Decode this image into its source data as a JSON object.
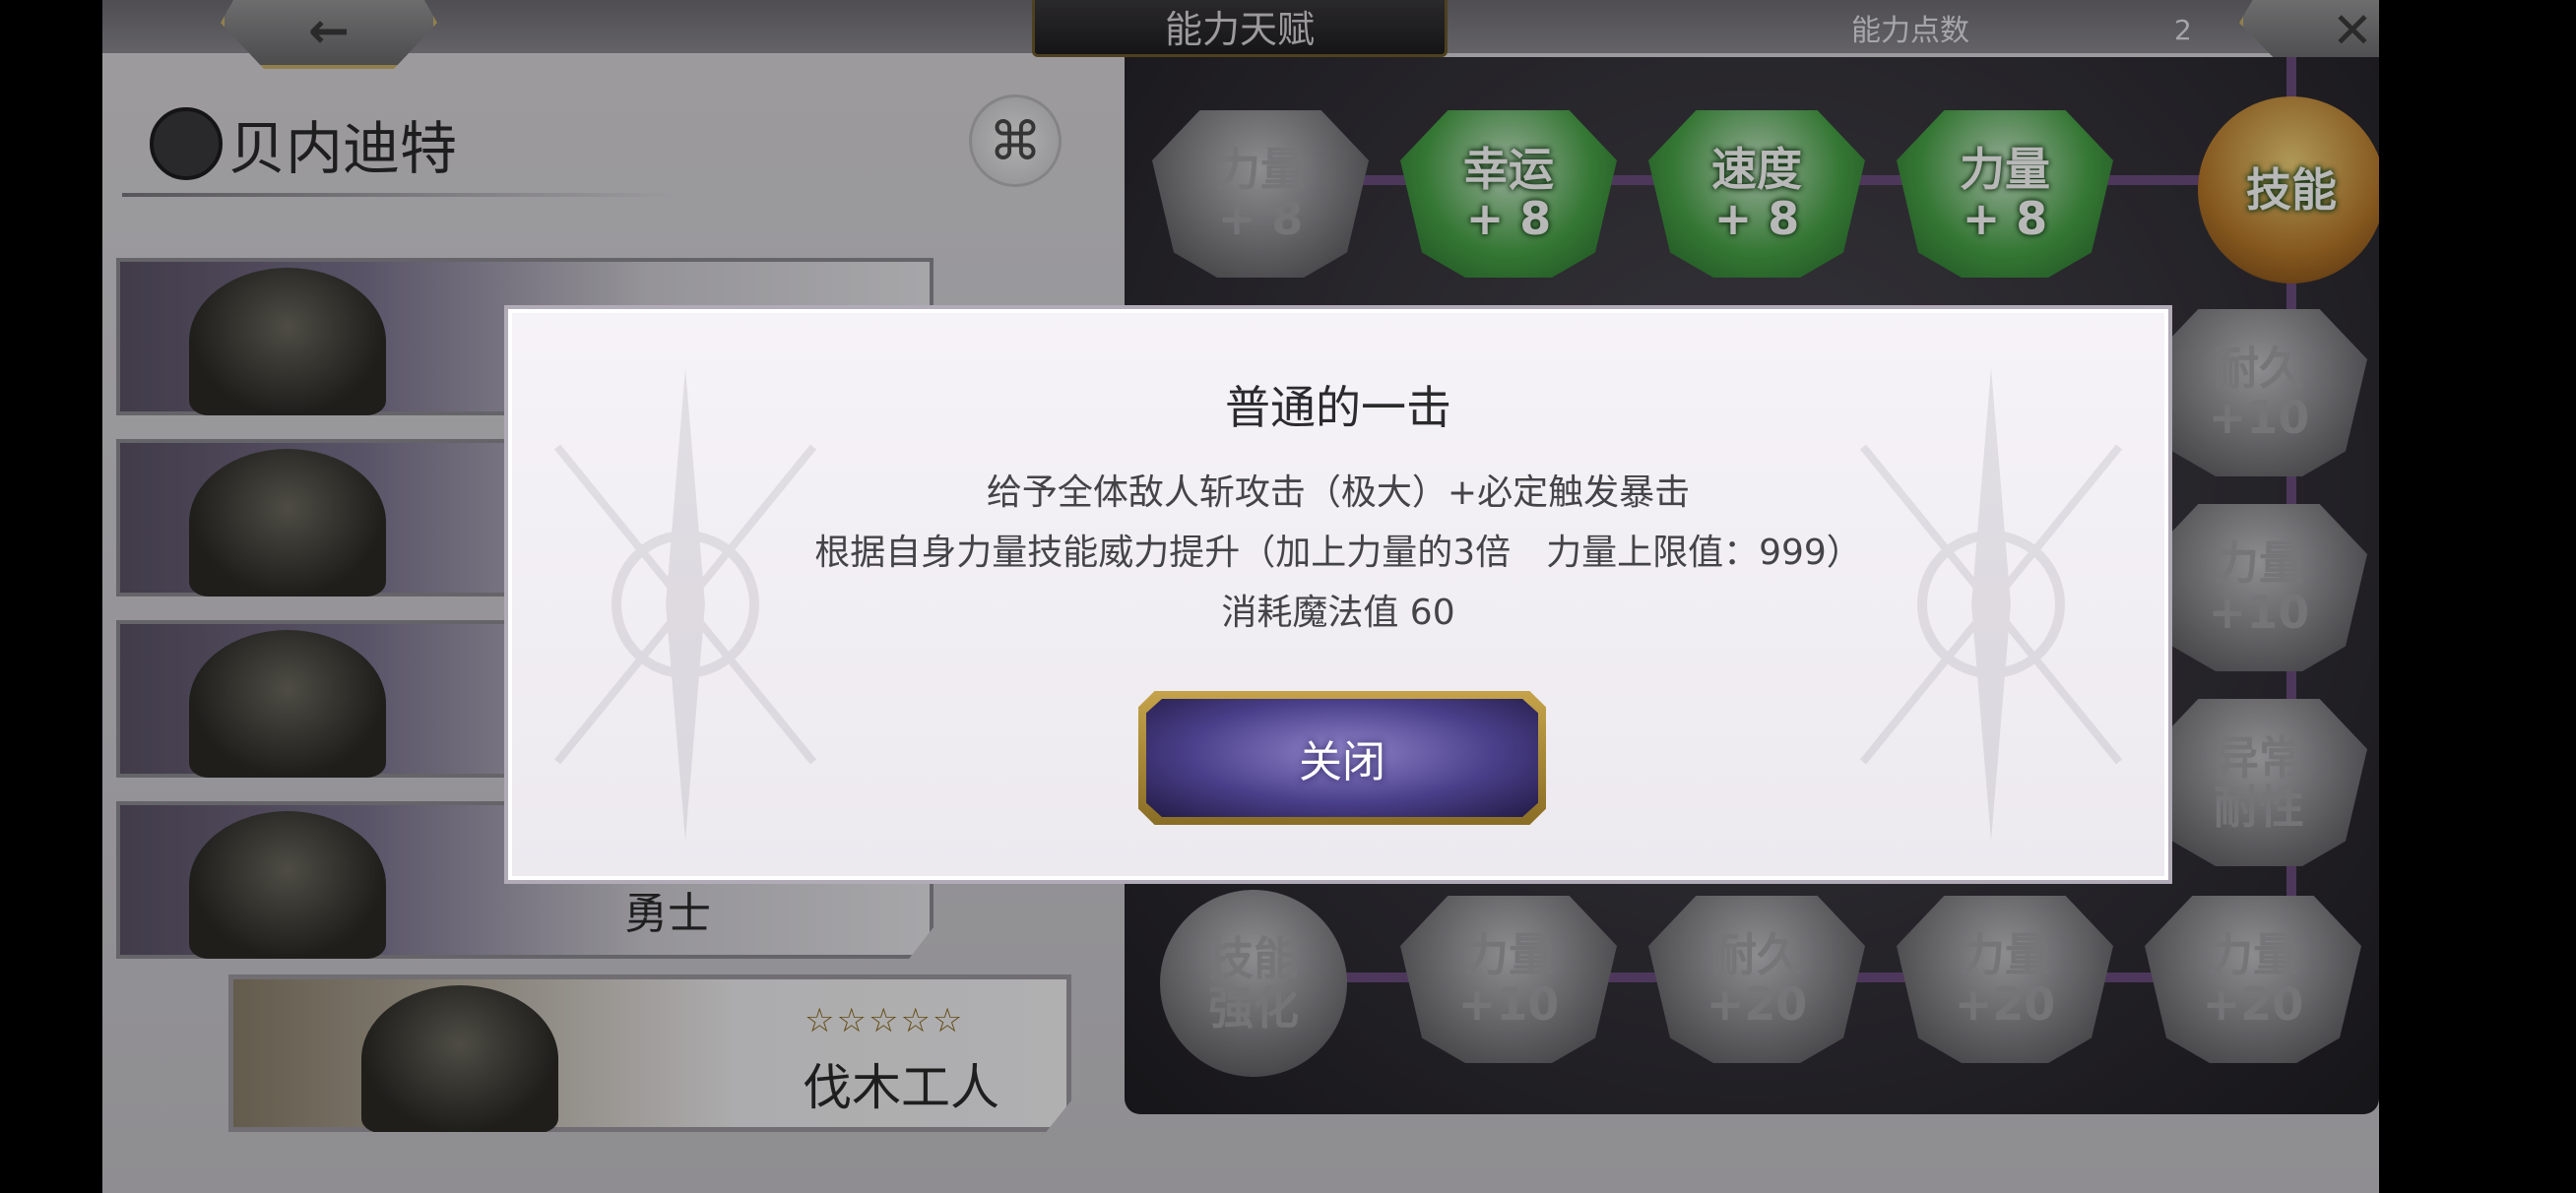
{
  "header": {
    "title": "能力天赋",
    "points_label": "能力点数",
    "points_value": "2",
    "back_glyph": "←",
    "close_glyph": "✕"
  },
  "character": {
    "name": "贝内迪特"
  },
  "class_cards": [
    {
      "label": ""
    },
    {
      "label": ""
    },
    {
      "label": ""
    },
    {
      "label": "勇士"
    }
  ],
  "featured_card": {
    "stars": "☆☆☆☆☆",
    "name": "伐木工人"
  },
  "talent_nodes": [
    {
      "text": "力量\n+ 8",
      "style": "gray"
    },
    {
      "text": "幸运\n+ 8",
      "style": "green"
    },
    {
      "text": "速度\n+ 8",
      "style": "green"
    },
    {
      "text": "力量\n+ 8",
      "style": "green"
    },
    {
      "text": "技能",
      "style": "gold"
    },
    {
      "text": "耐久\n+10",
      "style": "gray"
    },
    {
      "text": "力量\n+10",
      "style": "gray"
    },
    {
      "text": "异常\n耐性",
      "style": "gray"
    },
    {
      "text": "技能\n强化",
      "style": "gray"
    },
    {
      "text": "力量\n+10",
      "style": "gray"
    },
    {
      "text": "耐久\n+20",
      "style": "gray"
    },
    {
      "text": "力量\n+20",
      "style": "gray"
    },
    {
      "text": "力量\n+20",
      "style": "gray"
    }
  ],
  "dialog": {
    "title": "普通的一击",
    "lines": [
      "给予全体敌人斩攻击（极大）+必定触发暴击",
      "根据自身力量技能威力提升（加上力量的3倍　力量上限值：999）",
      "消耗魔法值 60"
    ],
    "close_label": "关闭"
  },
  "colors": {
    "accent_gold": "#c5a34b",
    "button_purple": "#4a3f8a",
    "gem_green": "#49a548",
    "tree_line": "#6b4d7e"
  }
}
